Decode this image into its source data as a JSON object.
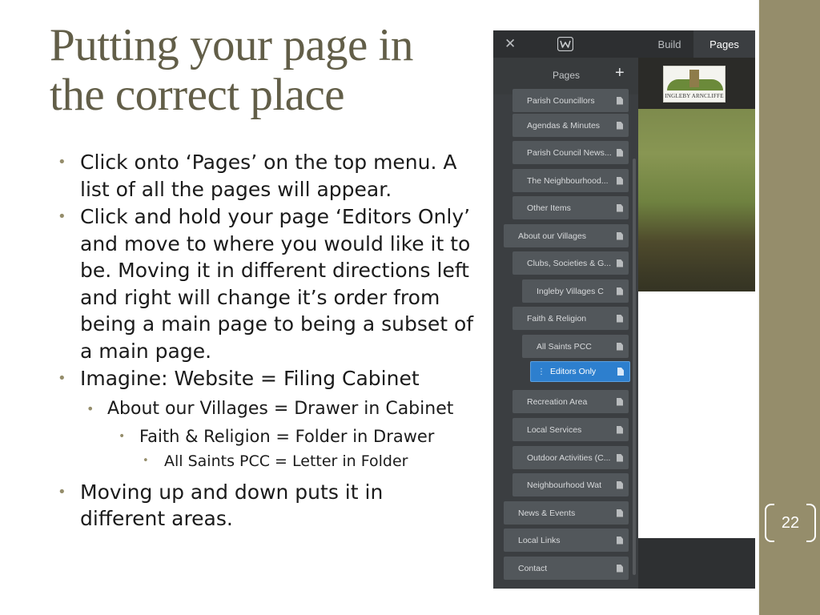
{
  "slide": {
    "title_line1": "Putting your page in",
    "title_line2": "the correct place",
    "page_number": "22",
    "bullets": [
      {
        "level": 1,
        "text": "Click onto ‘Pages’ on the top menu. A list of all the pages will appear."
      },
      {
        "level": 1,
        "text": "Click and hold your page ‘Editors Only’ and move to where you would like it to be. Moving it in different directions left and right will change it’s order from being a main page to being a subset of a main page."
      },
      {
        "level": 1,
        "text": "Imagine: Website = Filing Cabinet"
      },
      {
        "level": 2,
        "text": "About our Villages = Drawer in Cabinet"
      },
      {
        "level": 3,
        "text": "Faith & Religion = Folder in Drawer"
      },
      {
        "level": 4,
        "text": "All Saints PCC = Letter in Folder"
      },
      {
        "level": 1,
        "text": "Moving up and down puts it in different areas."
      }
    ],
    "colors": {
      "accent": "#958d6b",
      "title": "#625e48"
    }
  },
  "editor": {
    "close_icon": "close-icon",
    "logo_icon": "w-logo-icon",
    "tabs": {
      "build": "Build",
      "pages": "Pages"
    },
    "panel_title": "Pages",
    "add_icon": "plus-icon",
    "pages": [
      {
        "label": "Parish Councillors",
        "indent": 1
      },
      {
        "label": "Agendas & Minutes",
        "indent": 1
      },
      {
        "label": "Parish Council News...",
        "indent": 1
      },
      {
        "label": "The Neighbourhood...",
        "indent": 1
      },
      {
        "label": "Other Items",
        "indent": 1
      },
      {
        "label": "About our Villages",
        "indent": 0
      },
      {
        "label": "Clubs, Societies & G...",
        "indent": 1
      },
      {
        "label": "Ingleby Villages C",
        "indent": 2
      },
      {
        "label": "Faith & Religion",
        "indent": 1
      },
      {
        "label": "All Saints PCC",
        "indent": 2
      },
      {
        "label": "Editors Only",
        "indent": 3,
        "active": true
      },
      {
        "label": "Recreation Area",
        "indent": 1
      },
      {
        "label": "Local Services",
        "indent": 1
      },
      {
        "label": "Outdoor Activities (C...",
        "indent": 1
      },
      {
        "label": "Neighbourhood Wat",
        "indent": 1
      },
      {
        "label": "News & Events",
        "indent": 0
      },
      {
        "label": "Local Links",
        "indent": 0
      },
      {
        "label": "Contact",
        "indent": 0
      }
    ],
    "preview_logo_text": "INGLEBY ARNCLIFFE"
  }
}
